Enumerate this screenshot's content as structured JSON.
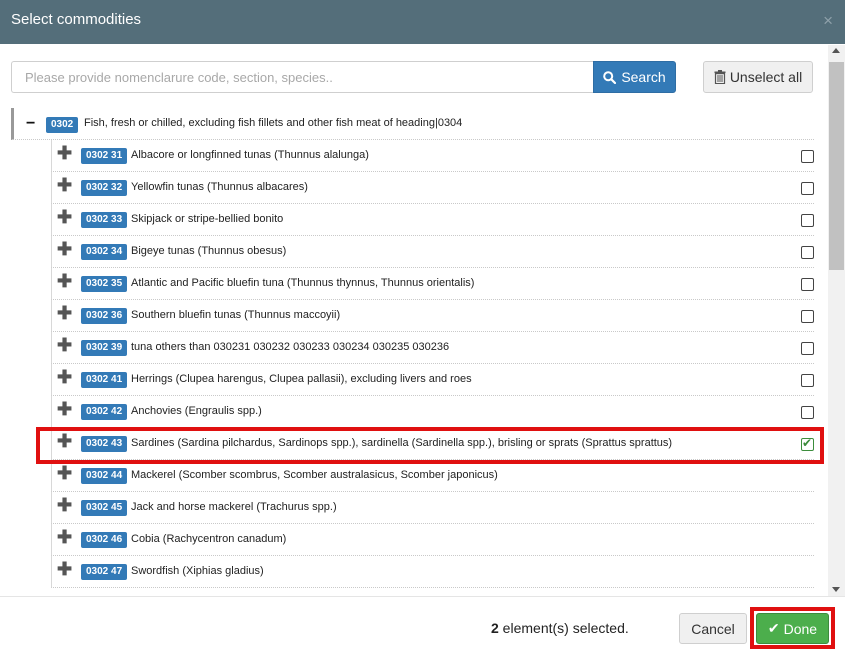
{
  "dialog": {
    "title": "Select commodities",
    "close_glyph": "×"
  },
  "search": {
    "placeholder": "Please provide nomenclarure code, section, species..",
    "value": "",
    "button_label": "Search",
    "button_icon": "search-icon"
  },
  "unselect_all": {
    "label": "Unselect all",
    "icon": "trash-icon"
  },
  "tree": {
    "parent": {
      "toggle": "−",
      "code": "0302",
      "label": "Fish, fresh or chilled, excluding fish fillets and other fish meat of heading|0304"
    },
    "items": [
      {
        "code": "0302 31",
        "label": "Albacore or longfinned tunas (Thunnus alalunga)",
        "checked": false,
        "has_checkbox": true
      },
      {
        "code": "0302 32",
        "label": "Yellowfin tunas (Thunnus albacares)",
        "checked": false,
        "has_checkbox": true
      },
      {
        "code": "0302 33",
        "label": "Skipjack or stripe-bellied bonito",
        "checked": false,
        "has_checkbox": true
      },
      {
        "code": "0302 34",
        "label": "Bigeye tunas (Thunnus obesus)",
        "checked": false,
        "has_checkbox": true
      },
      {
        "code": "0302 35",
        "label": "Atlantic and Pacific bluefin tuna (Thunnus thynnus, Thunnus orientalis)",
        "checked": false,
        "has_checkbox": true
      },
      {
        "code": "0302 36",
        "label": "Southern bluefin tunas (Thunnus maccoyii)",
        "checked": false,
        "has_checkbox": true
      },
      {
        "code": "0302 39",
        "label": "tuna others than 030231 030232 030233 030234 030235 030236",
        "checked": false,
        "has_checkbox": true
      },
      {
        "code": "0302 41",
        "label": "Herrings (Clupea harengus, Clupea pallasii), excluding livers and roes",
        "checked": false,
        "has_checkbox": true
      },
      {
        "code": "0302 42",
        "label": "Anchovies (Engraulis spp.)",
        "checked": false,
        "has_checkbox": true
      },
      {
        "code": "0302 43",
        "label": "Sardines (Sardina pilchardus, Sardinops spp.), sardinella (Sardinella spp.), brisling or sprats (Sprattus sprattus)",
        "checked": true,
        "has_checkbox": true
      },
      {
        "code": "0302 44",
        "label": "Mackerel (Scomber scombrus, Scomber australasicus, Scomber japonicus)",
        "checked": false,
        "has_checkbox": false
      },
      {
        "code": "0302 45",
        "label": "Jack and horse mackerel (Trachurus spp.)",
        "checked": false,
        "has_checkbox": false
      },
      {
        "code": "0302 46",
        "label": "Cobia (Rachycentron canadum)",
        "checked": false,
        "has_checkbox": false
      },
      {
        "code": "0302 47",
        "label": "Swordfish (Xiphias gladius)",
        "checked": false,
        "has_checkbox": false
      }
    ],
    "expand_glyph": "✚"
  },
  "footer": {
    "selected_count": "2",
    "selected_text": " element(s) selected.",
    "cancel_label": "Cancel",
    "done_label": "Done",
    "done_icon": "check-icon"
  },
  "colors": {
    "header_bg": "#546e7a",
    "badge_bg": "#337ab7",
    "done_bg": "#4cae4c",
    "highlight": "#e01010"
  }
}
